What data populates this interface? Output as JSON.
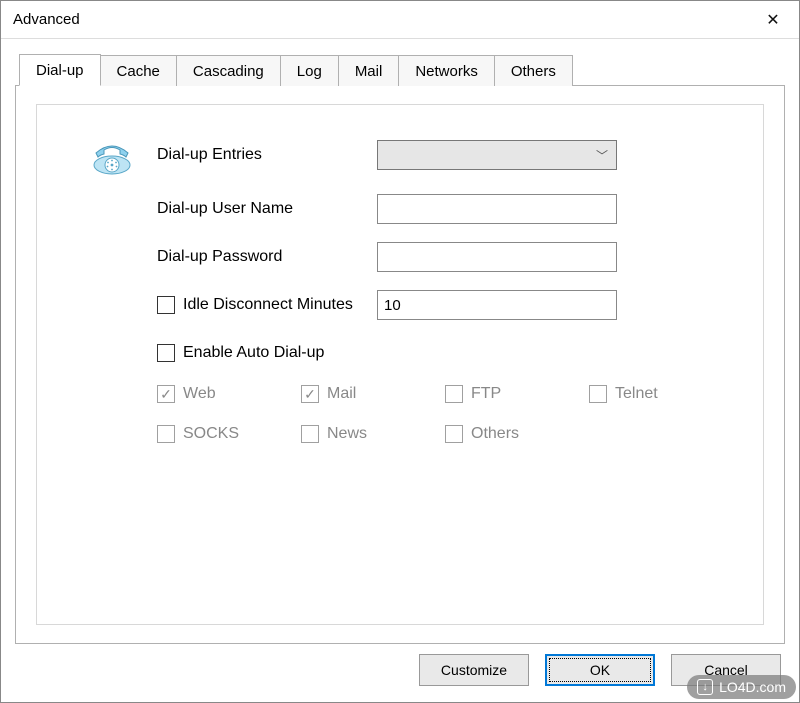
{
  "window": {
    "title": "Advanced"
  },
  "tabs": [
    {
      "label": "Dial-up",
      "active": true
    },
    {
      "label": "Cache"
    },
    {
      "label": "Cascading"
    },
    {
      "label": "Log"
    },
    {
      "label": "Mail"
    },
    {
      "label": "Networks"
    },
    {
      "label": "Others"
    }
  ],
  "form": {
    "dialup_entries_label": "Dial-up Entries",
    "dialup_entries_value": "",
    "username_label": "Dial-up User Name",
    "username_value": "",
    "password_label": "Dial-up Password",
    "password_value": "",
    "idle_label": "Idle Disconnect Minutes",
    "idle_checked": false,
    "idle_value": "10",
    "enable_auto_label": "Enable Auto Dial-up",
    "enable_auto_checked": false
  },
  "protocols": [
    {
      "label": "Web",
      "checked": true,
      "disabled": true
    },
    {
      "label": "Mail",
      "checked": true,
      "disabled": true
    },
    {
      "label": "FTP",
      "checked": false,
      "disabled": true
    },
    {
      "label": "Telnet",
      "checked": false,
      "disabled": true
    },
    {
      "label": "SOCKS",
      "checked": false,
      "disabled": true
    },
    {
      "label": "News",
      "checked": false,
      "disabled": true
    },
    {
      "label": "Others",
      "checked": false,
      "disabled": true
    }
  ],
  "buttons": {
    "customize": "Customize",
    "ok": "OK",
    "cancel": "Cancel"
  },
  "watermark": "LO4D.com"
}
